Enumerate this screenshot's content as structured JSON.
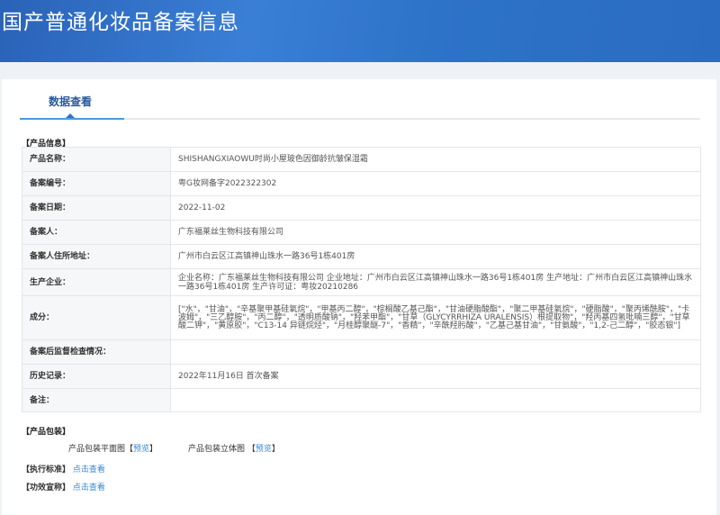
{
  "header": {
    "title": "国产普通化妆品备案信息"
  },
  "tab": {
    "label": "数据查看"
  },
  "product_info": {
    "section_title": "【产品信息】",
    "rows": [
      {
        "label": "产品名称：",
        "value": "SHISHANGXIAOWU时尚小屋玻色因御龄抗皱保湿霜"
      },
      {
        "label": "备案编号：",
        "value": "粤G妆网备字2022322302"
      },
      {
        "label": "备案日期：",
        "value": "2022-11-02"
      },
      {
        "label": "备案人：",
        "value": "广东福莱丝生物科技有限公司"
      },
      {
        "label": "备案人住所地址：",
        "value": "广州市白云区江高镇神山珠水一路36号1栋401房"
      },
      {
        "label": "生产企业：",
        "value": "企业名称：广东福莱丝生物科技有限公司 企业地址：广州市白云区江高镇神山珠水一路36号1栋401房 生产地址：广州市白云区江高镇神山珠水一路36号1栋401房 生产许可证：粤妆20210286"
      },
      {
        "label": "成分：",
        "value": "[\"水\"，\"甘油\"，\"辛基聚甲基硅氧烷\"，\"甲基丙二醇\"，\"棕榈酸乙基己酯\"，\"甘油硬脂酸酯\"，\"聚二甲基硅氧烷\"，\"硬脂酸\"，\"聚丙烯酰胺\"，\"卡波姆\"，\"三乙醇胺\"，\"丙二醇\"，\"透明质酸钠\"，\"羟苯甲酯\"，\"甘草（GLYCYRRHIZA URALENSIS）根提取物\"，\"羟丙基四氢吡喃三醇\"，\"甘草酸二钾\"，\"黄原胶\"，\"C13-14 异链烷烃\"，\"月桂醇聚醚-7\"，\"香精\"，\"辛酰羟肟酸\"，\"乙基己基甘油\"，\"甘氨酸\"，\"1,2-己二醇\"，\"胶态银\"]"
      },
      {
        "label": "备案后监督检查情况：",
        "value": ""
      },
      {
        "label": "历史记录：",
        "value": "2022年11月16日 首次备案"
      },
      {
        "label": "备注：",
        "value": ""
      }
    ]
  },
  "packaging": {
    "section_title": "【产品包装】",
    "flat_label": "产品包装平面图",
    "stereo_label": "产品包装立体图",
    "bracket_open": "【",
    "bracket_close": "】",
    "preview_link": "预览"
  },
  "standard": {
    "label": "【执行标准】",
    "link": "点击查看"
  },
  "efficacy": {
    "label": "【功效宣称】",
    "link": "点击查看"
  }
}
